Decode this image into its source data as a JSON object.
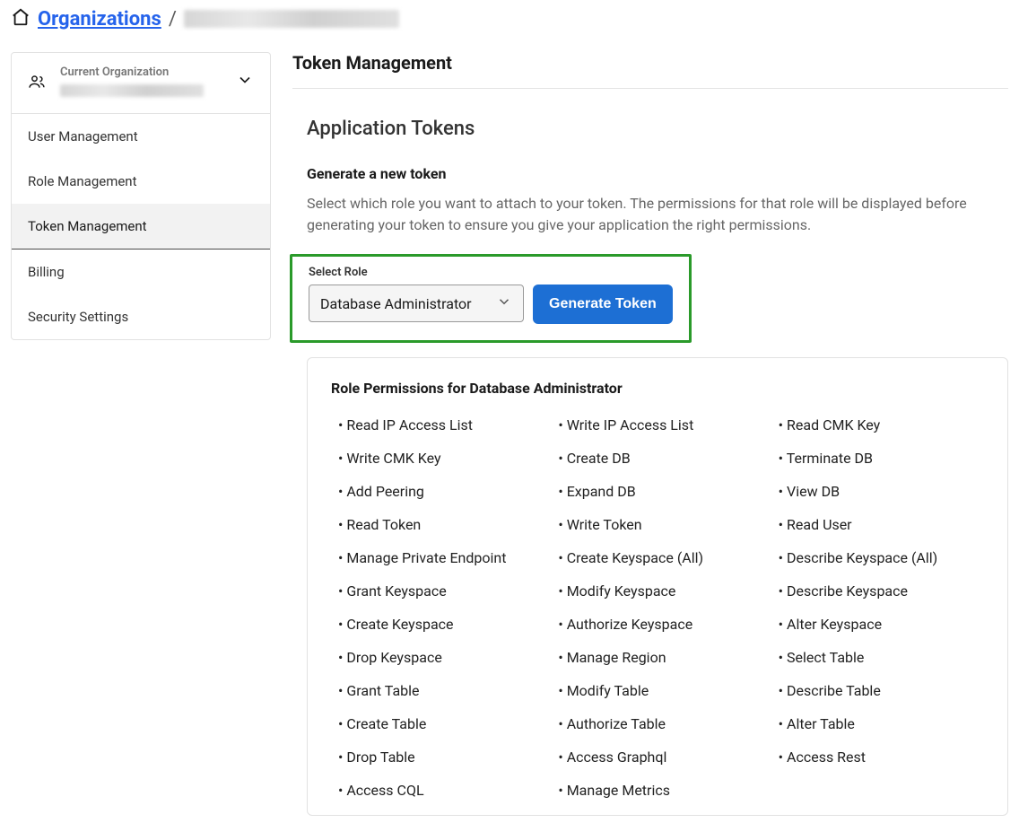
{
  "breadcrumb": {
    "link_label": "Organizations",
    "separator": "/"
  },
  "sidebar": {
    "current_org_label": "Current Organization",
    "items": [
      {
        "label": "User Management"
      },
      {
        "label": "Role Management"
      },
      {
        "label": "Token Management",
        "active": true
      },
      {
        "label": "Billing"
      },
      {
        "label": "Security Settings"
      }
    ]
  },
  "main": {
    "page_title": "Token Management",
    "section_title": "Application Tokens",
    "generate": {
      "heading": "Generate a new token",
      "description": "Select which role you want to attach to your token. The permissions for that role will be displayed before generating your token to ensure you give your application the right permissions.",
      "select_label": "Select Role",
      "selected_role": "Database Administrator",
      "button_label": "Generate Token"
    },
    "permissions": {
      "title": "Role Permissions for Database Administrator",
      "list": [
        "Read IP Access List",
        "Write IP Access List",
        "Read CMK Key",
        "Write CMK Key",
        "Create DB",
        "Terminate DB",
        "Add Peering",
        "Expand DB",
        "View DB",
        "Read Token",
        "Write Token",
        "Read User",
        "Manage Private Endpoint",
        "Create Keyspace (All)",
        "Describe Keyspace (All)",
        "Grant Keyspace",
        "Modify Keyspace",
        "Describe Keyspace",
        "Create Keyspace",
        "Authorize Keyspace",
        "Alter Keyspace",
        "Drop Keyspace",
        "Manage Region",
        "Select Table",
        "Grant Table",
        "Modify Table",
        "Describe Table",
        "Create Table",
        "Authorize Table",
        "Alter Table",
        "Drop Table",
        "Access Graphql",
        "Access Rest",
        "Access CQL",
        "Manage Metrics"
      ]
    }
  }
}
